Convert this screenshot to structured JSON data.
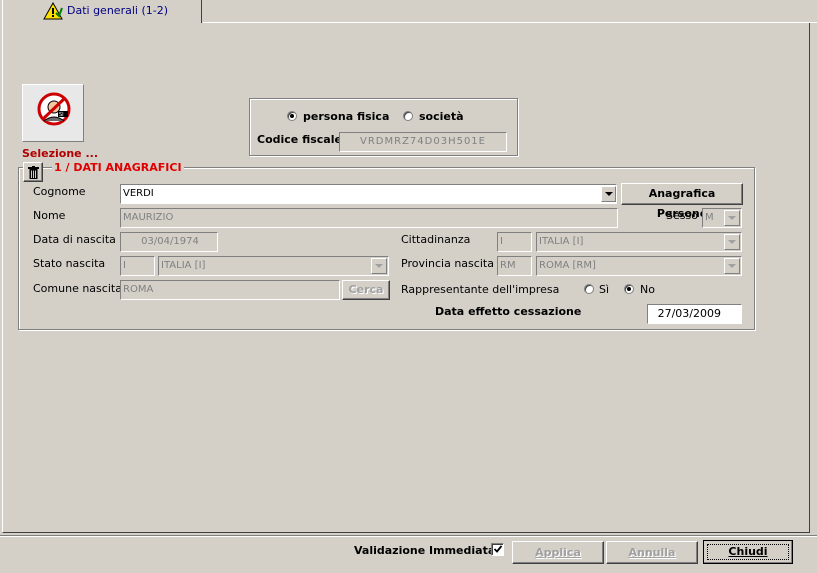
{
  "tab": {
    "label": "Dati generali (1-2)"
  },
  "selector": {
    "label": "Selezione ..."
  },
  "person_type": {
    "options": [
      "persona fisica",
      "società"
    ],
    "selected": "persona fisica",
    "codice_fiscale_label": "Codice fiscale",
    "codice_fiscale_value": "VRDMRZ74D03H501E"
  },
  "section": {
    "title": "1 / DATI ANAGRAFICI"
  },
  "form": {
    "cognome_label": "Cognome",
    "cognome_value": "VERDI",
    "anagrafica_button": "Anagrafica Persone",
    "nome_label": "Nome",
    "nome_value": "MAURIZIO",
    "sesso_label": "Sesso",
    "sesso_value": "M",
    "data_nascita_label": "Data di nascita",
    "data_nascita_value": "03/04/1974",
    "cittadinanza_label": "Cittadinanza",
    "cittadinanza_code": "I",
    "cittadinanza_value": "ITALIA [I]",
    "stato_nascita_label": "Stato nascita",
    "stato_nascita_code": "I",
    "stato_nascita_value": "ITALIA [I]",
    "provincia_label": "Provincia nascita",
    "provincia_code": "RM",
    "provincia_value": "ROMA [RM]",
    "comune_label": "Comune nascita",
    "comune_value": "ROMA",
    "cerca_button": "Cerca",
    "rappresentante_label": "Rappresentante dell'impresa",
    "rappresentante_options": [
      "Sì",
      "No"
    ],
    "rappresentante_selected": "No",
    "cessazione_label": "Data effetto cessazione",
    "cessazione_value": "27/03/2009"
  },
  "footer": {
    "validazione_label": "Validazione Immediata",
    "validazione_checked": true,
    "applica": "Applica",
    "annulla": "Annulla",
    "chiudi": "Chiudi"
  }
}
